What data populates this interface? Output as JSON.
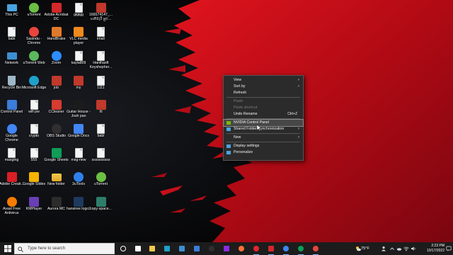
{
  "desktop": {
    "icons": [
      {
        "label": "This PC",
        "kind": "pc",
        "color": "#4aa3df"
      },
      {
        "label": "uTorrent",
        "kind": "round",
        "color": "#6cbf43"
      },
      {
        "label": "Adobe Acrobat DC",
        "kind": "app",
        "color": "#d4282b"
      },
      {
        "label": "gigigg",
        "kind": "file",
        "color": "#f4f4f4"
      },
      {
        "label": "166574147_... හනිමැරි පුළු...",
        "kind": "app",
        "color": "#c0392b"
      },
      {
        "label": "babi",
        "kind": "file",
        "color": "#f4f4f4"
      },
      {
        "label": "Sasindu - Chrome",
        "kind": "round",
        "color": "#e8453c"
      },
      {
        "label": "HandBrake",
        "kind": "app",
        "color": "#e07a2a"
      },
      {
        "label": "VLC media player",
        "kind": "app",
        "color": "#f08a1c"
      },
      {
        "label": "imali",
        "kind": "file",
        "color": "#f4f4f4"
      },
      {
        "label": "Network",
        "kind": "pc",
        "color": "#3d8fd1"
      },
      {
        "label": "uTorrent Web",
        "kind": "round",
        "color": "#5cb85c"
      },
      {
        "label": "Zoom",
        "kind": "round",
        "color": "#2d8cff"
      },
      {
        "label": "kayla809",
        "kind": "file",
        "color": "#f4f4f4"
      },
      {
        "label": "Hanihaoft Keyshepher...",
        "kind": "file",
        "color": "#f4f4f4"
      },
      {
        "label": "Recycle Bin",
        "kind": "bin",
        "color": "#9fb7c9"
      },
      {
        "label": "Microsoft Edge",
        "kind": "round",
        "color": "#1fa0c9"
      },
      {
        "label": "job",
        "kind": "app",
        "color": "#c0392b"
      },
      {
        "label": "my",
        "kind": "app",
        "color": "#c0392b"
      },
      {
        "label": "1111",
        "kind": "file",
        "color": "#f4f4f4"
      },
      {
        "label": "Control Panel",
        "kind": "app",
        "color": "#3b7dd8"
      },
      {
        "label": "wifi pw",
        "kind": "file",
        "color": "#f4f4f4"
      },
      {
        "label": "CCleaner",
        "kind": "app",
        "color": "#d63c2f"
      },
      {
        "label": "Guitar House - Josh pan",
        "kind": "app",
        "color": "#1b1b1b"
      },
      {
        "label": "III",
        "kind": "app",
        "color": "#c0392b"
      },
      {
        "label": "Google Chrome",
        "kind": "round",
        "color": "#4285f4"
      },
      {
        "label": "crypto",
        "kind": "file",
        "color": "#f4f4f4"
      },
      {
        "label": "OBS Studio",
        "kind": "round",
        "color": "#302e31"
      },
      {
        "label": "Google Docs",
        "kind": "app",
        "color": "#4285f4"
      },
      {
        "label": "babi",
        "kind": "file",
        "color": "#f4f4f4"
      },
      {
        "label": "masging",
        "kind": "file",
        "color": "#f4f4f4"
      },
      {
        "label": "555",
        "kind": "file",
        "color": "#f4f4f4"
      },
      {
        "label": "Google Sheets",
        "kind": "app",
        "color": "#0f9d58"
      },
      {
        "label": "msg-new",
        "kind": "file",
        "color": "#f4f4f4"
      },
      {
        "label": "ssssssssss",
        "kind": "file",
        "color": "#f4f4f4"
      },
      {
        "label": "Adobe Creati...",
        "kind": "app",
        "color": "#da1f26"
      },
      {
        "label": "Google Slides",
        "kind": "app",
        "color": "#f4b400"
      },
      {
        "label": "New folder",
        "kind": "folder",
        "color": "#f2c94c"
      },
      {
        "label": "3uTools",
        "kind": "round",
        "color": "#2f80ed"
      },
      {
        "label": "uTorrent",
        "kind": "round",
        "color": "#6cbf43"
      },
      {
        "label": "Avast Free Antivirus",
        "kind": "round",
        "color": "#f57c00"
      },
      {
        "label": "KMPlayer",
        "kind": "app",
        "color": "#6a3fb5"
      },
      {
        "label": "Aurora MC",
        "kind": "app",
        "color": "#2c2c2c"
      },
      {
        "label": "hansiree logo2",
        "kind": "app",
        "color": "#1e3a5f"
      },
      {
        "label": "copy-space...",
        "kind": "app",
        "color": "#2e7d6b"
      }
    ]
  },
  "context_menu": {
    "items": [
      {
        "label": "View",
        "submenu": true
      },
      {
        "label": "Sort by",
        "submenu": true
      },
      {
        "label": "Refresh"
      },
      {
        "separator": true
      },
      {
        "label": "Paste",
        "disabled": true
      },
      {
        "label": "Paste shortcut",
        "disabled": true
      },
      {
        "label": "Undo Rename",
        "shortcut": "Ctrl+Z"
      },
      {
        "separator": true
      },
      {
        "label": "NVIDIA Control Panel",
        "icon": "nvidia-icon",
        "highlighted": true
      },
      {
        "label": "Shared Folder Synchronization",
        "icon": "sync-icon",
        "submenu": true
      },
      {
        "separator": true
      },
      {
        "label": "New",
        "submenu": true
      },
      {
        "separator": true
      },
      {
        "label": "Display settings",
        "icon": "display-icon"
      },
      {
        "label": "Personalize",
        "icon": "personalize-icon"
      }
    ]
  },
  "taskbar": {
    "search_placeholder": "Type here to search",
    "weather_temp": "75°F",
    "time": "2:23 PM",
    "date": "10/17/2022",
    "pinned": [
      {
        "name": "cortana",
        "color": "#ffffff"
      },
      {
        "name": "task-view",
        "color": "#ffffff"
      },
      {
        "name": "file-explorer",
        "color": "#f2c94c"
      },
      {
        "name": "edge",
        "color": "#1fa0c9"
      },
      {
        "name": "store",
        "color": "#3d8fd1"
      },
      {
        "name": "mail",
        "color": "#3b7dd8"
      },
      {
        "name": "obs",
        "color": "#302e31"
      },
      {
        "name": "photos",
        "color": "#8a2be2"
      },
      {
        "name": "firefox",
        "color": "#ff7139"
      },
      {
        "name": "opera",
        "color": "#e3262e"
      },
      {
        "name": "pdf",
        "color": "#d4282b"
      },
      {
        "name": "chrome",
        "color": "#4285f4"
      },
      {
        "name": "chrome-profile",
        "color": "#0f9d58"
      },
      {
        "name": "chrome-profile-2",
        "color": "#e8453c"
      }
    ]
  }
}
